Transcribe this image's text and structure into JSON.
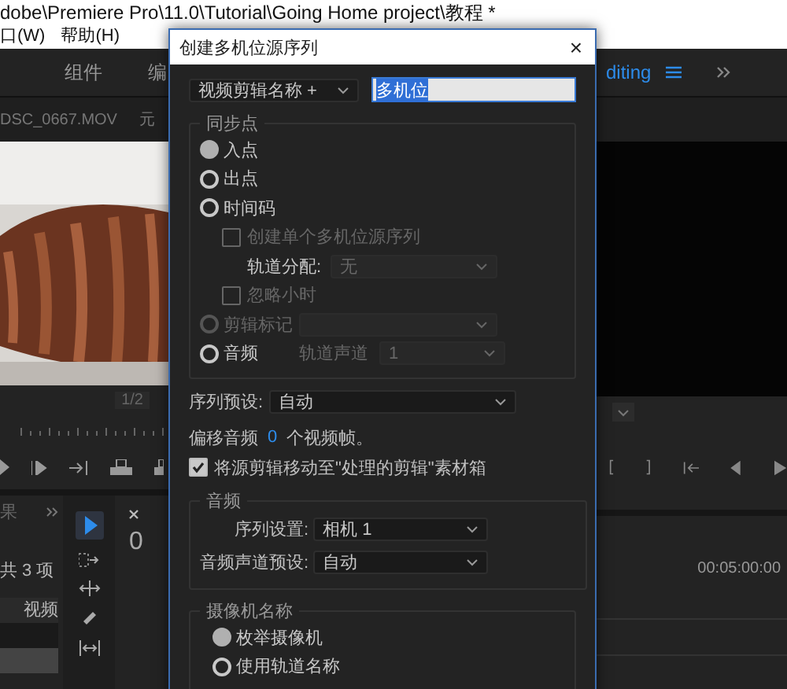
{
  "title_bar": {
    "title": "dobe\\Premiere Pro\\11.0\\Tutorial\\Going Home project\\教程 *"
  },
  "menu": [
    "口(W)",
    "帮助(H)"
  ],
  "workspaces": [
    {
      "label": "组件",
      "selected": false
    },
    {
      "label": "编",
      "selected": false
    },
    {
      "label": "diting",
      "selected": true
    }
  ],
  "panel_tabs": [
    "DSC_0667.MOV",
    "元"
  ],
  "source_monitor": {
    "page": "1/2"
  },
  "project_panel": {
    "tab": "果",
    "item_count": "共 3 项",
    "column": "视频"
  },
  "timeline": {
    "timecode": "0",
    "ruler_time": "00:05:00:00"
  },
  "dialog": {
    "title": "创建多机位源序列",
    "close": "×",
    "name_source": "视频剪辑名称 +",
    "name": "多机位",
    "sync_group": {
      "label": "同步点",
      "items": [
        {
          "kind": "radio",
          "label": "入点",
          "selected": true,
          "disabled": false
        },
        {
          "kind": "radio",
          "label": "出点",
          "selected": false,
          "disabled": false
        },
        {
          "kind": "radio",
          "label": "时间码",
          "selected": false,
          "disabled": false
        },
        {
          "kind": "checkbox",
          "label": "创建单个多机位源序列",
          "checked": false,
          "disabled": true
        },
        {
          "kind": "select",
          "label": "轨道分配:",
          "value": "无",
          "disabled": true
        },
        {
          "kind": "checkbox",
          "label": "忽略小时",
          "checked": false,
          "disabled": true
        },
        {
          "kind": "radio",
          "label": "剪辑标记",
          "selected": false,
          "disabled": true,
          "field": {
            "disabled": true
          }
        },
        {
          "kind": "radio",
          "label": "音频",
          "selected": false,
          "disabled": false,
          "field": {
            "label": "轨道声道",
            "value": "1",
            "disabled": true
          }
        }
      ]
    },
    "preset": {
      "label": "序列预设:",
      "value": "自动"
    },
    "offset": {
      "label": "偏移音频",
      "value": "0",
      "unit": "个视频帧。"
    },
    "move_clips": {
      "label": "将源剪辑移动至\"处理的剪辑\"素材箱",
      "checked": true
    },
    "audio_group": {
      "label": "音频",
      "fields": [
        {
          "label": "序列设置:",
          "value": "相机 1"
        },
        {
          "label": "音频声道预设:",
          "value": "自动"
        }
      ]
    },
    "camera_group": {
      "label": "摄像机名称",
      "options": [
        {
          "label": "枚举摄像机",
          "selected": true
        },
        {
          "label": "使用轨道名称",
          "selected": false
        }
      ]
    }
  }
}
